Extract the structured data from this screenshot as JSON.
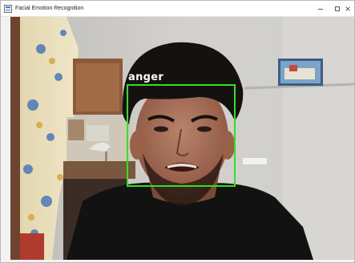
{
  "window": {
    "title": "Facial Emotion Recognition",
    "controls": {
      "minimize": "—",
      "maximize": "☐",
      "close": "✕"
    }
  },
  "detection": {
    "label": "anger",
    "box_color": "#32e01e",
    "label_color": "#ffffff"
  },
  "icons": {
    "app": "app-window-icon",
    "minimize": "minimize-icon",
    "maximize": "maximize-icon",
    "close": "close-icon"
  }
}
